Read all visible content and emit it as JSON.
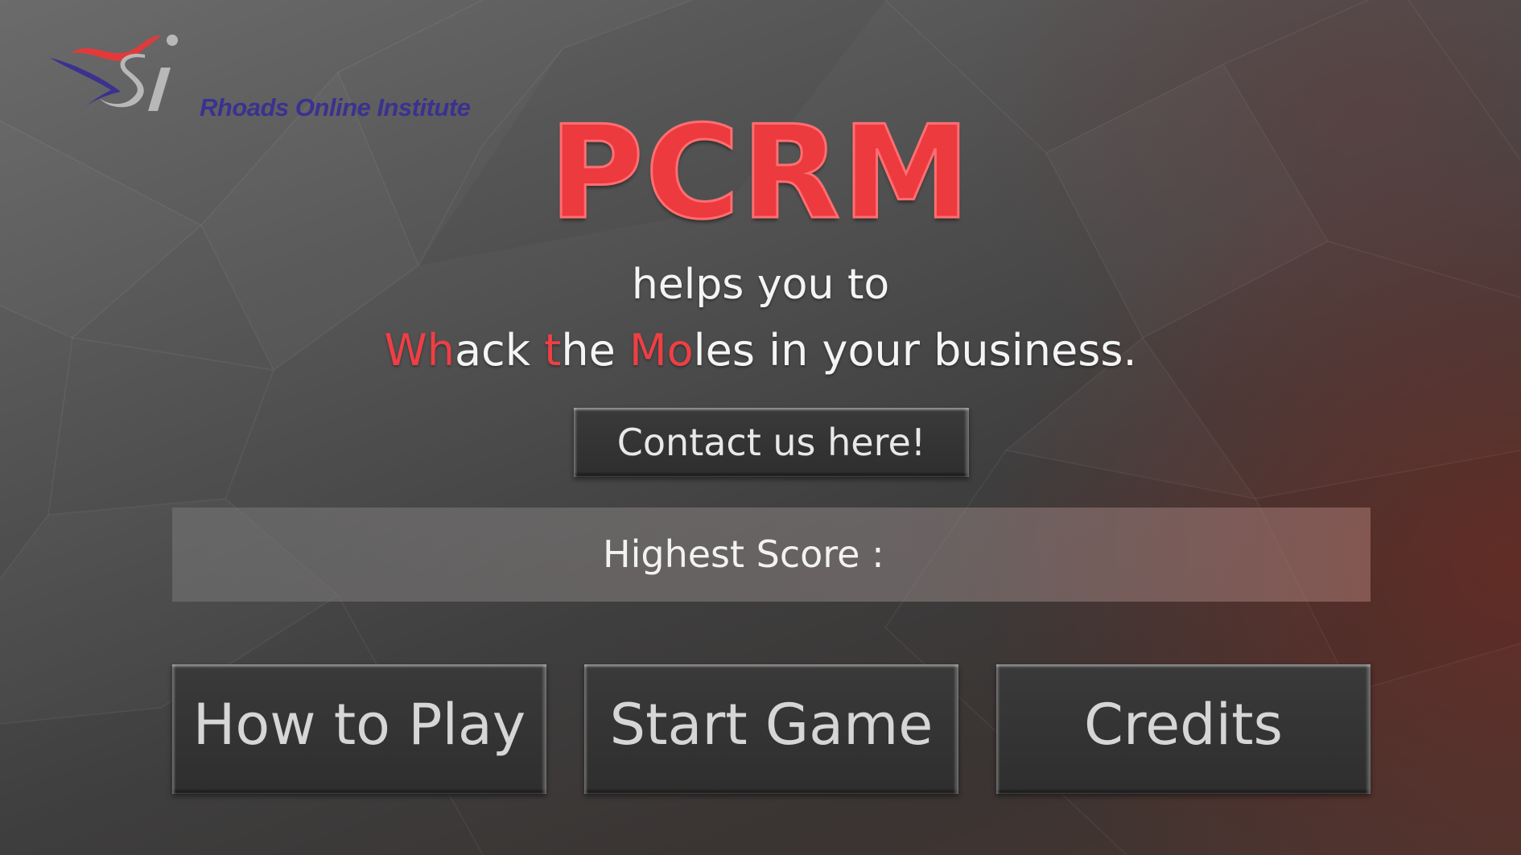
{
  "logo": {
    "organization": "Rhoads Online Institute"
  },
  "title": "PCRM",
  "tagline": {
    "line1": "helps you to",
    "line2_parts": [
      {
        "text": "Wh",
        "highlight": true
      },
      {
        "text": "ack ",
        "highlight": false
      },
      {
        "text": "t",
        "highlight": true
      },
      {
        "text": "he ",
        "highlight": false
      },
      {
        "text": "Mo",
        "highlight": true
      },
      {
        "text": "les in your business.",
        "highlight": false
      }
    ]
  },
  "contact_button": "Contact us here!",
  "score": {
    "label": "Highest Score :",
    "value": ""
  },
  "menu": {
    "how_to_play": "How to Play",
    "start_game": "Start Game",
    "credits": "Credits"
  },
  "colors": {
    "title_red": "#ec3a3f",
    "highlight_red": "#ee3f45",
    "logo_blue": "#3a3190",
    "button_dark": "#333333"
  }
}
